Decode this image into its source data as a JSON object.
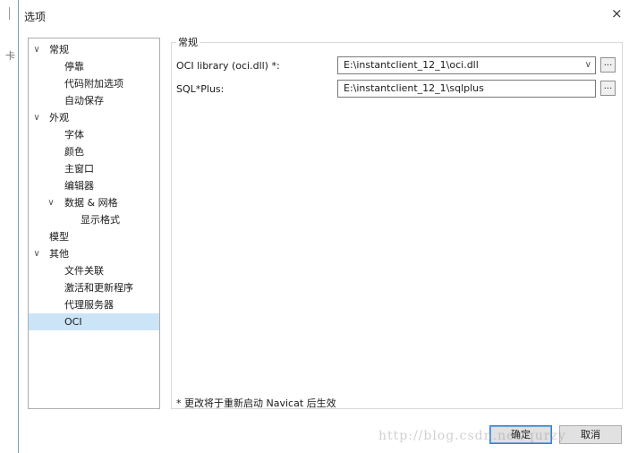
{
  "window": {
    "title": "选项",
    "close_glyph": "×"
  },
  "left_strip": {
    "mark": "卡"
  },
  "tree": {
    "items": [
      {
        "label": "常规",
        "expand": "∨"
      },
      {
        "label": "停靠"
      },
      {
        "label": "代码附加选项"
      },
      {
        "label": "自动保存"
      },
      {
        "label": "外观",
        "expand": "∨"
      },
      {
        "label": "字体"
      },
      {
        "label": "颜色"
      },
      {
        "label": "主窗口"
      },
      {
        "label": "编辑器"
      },
      {
        "label": "数据 & 网格",
        "expand": "∨"
      },
      {
        "label": "显示格式"
      },
      {
        "label": "模型"
      },
      {
        "label": "其他",
        "expand": "∨"
      },
      {
        "label": "文件关联"
      },
      {
        "label": "激活和更新程序"
      },
      {
        "label": "代理服务器"
      },
      {
        "label": "OCI",
        "selected": true
      }
    ]
  },
  "group": {
    "title": "常规"
  },
  "oci_library": {
    "label": "OCI library (oci.dll) *:",
    "value": "E:\\instantclient_12_1\\oci.dll",
    "browse": "..."
  },
  "sqlplus": {
    "label": "SQL*Plus:",
    "value": "E:\\instantclient_12_1\\sqlplus",
    "browse": "..."
  },
  "note": "* 更改将于重新启动 Navicat 后生效",
  "buttons": {
    "ok": "确定",
    "cancel": "取消"
  },
  "watermark": "http://blog.csdn.net/qurzy",
  "colors": {
    "selection": "#cce4f7",
    "accent_border": "#3b7ed0"
  }
}
